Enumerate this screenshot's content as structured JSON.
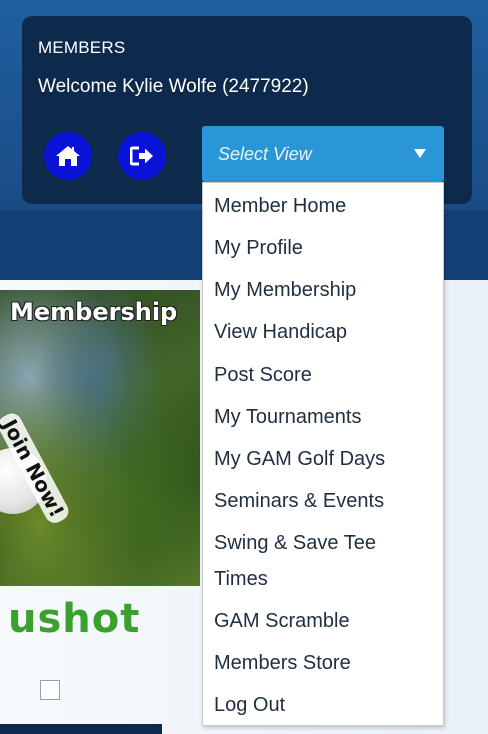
{
  "header": {
    "section_title": "MEMBERS",
    "welcome_text": "Welcome Kylie Wolfe (2477922)",
    "home_icon": "home-icon",
    "logout_icon": "sign-out-icon"
  },
  "view_select": {
    "placeholder": "Select View",
    "caret_icon": "caret-down-icon"
  },
  "menu": {
    "items": [
      "Member Home",
      "My Profile",
      "My Membership",
      "View Handicap",
      "Post Score",
      "My Tournaments",
      "My GAM Golf Days",
      "Seminars & Events",
      "Swing & Save Tee",
      "Times",
      "GAM Scramble",
      "Members Store",
      "Log Out"
    ]
  },
  "background": {
    "promo_caption": "Membership",
    "promo_badge": "Join Now!",
    "partner_logo": "ushot"
  },
  "colors": {
    "header_blue": "#1b4f88",
    "panel_navy": "#0d2a4c",
    "button_blue": "#0a14d8",
    "select_blue": "#2a96d8",
    "logo_green": "#3aa12f"
  }
}
